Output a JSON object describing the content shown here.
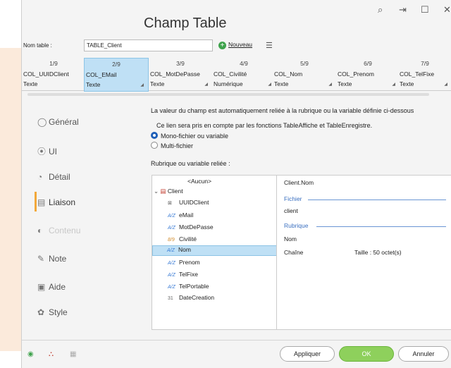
{
  "window": {
    "title": "Champ Table",
    "controls": [
      "⌕",
      "⇥",
      "☐",
      "✕"
    ]
  },
  "table_name": {
    "label": "Nom table :",
    "value": "TABLE_Client",
    "new_label": "Nouveau"
  },
  "columns": [
    {
      "index": "1/9",
      "name": "COL_UUIDClient",
      "type": "Texte"
    },
    {
      "index": "2/9",
      "name": "COL_EMail",
      "type": "Texte"
    },
    {
      "index": "3/9",
      "name": "COL_MotDePasse",
      "type": "Texte"
    },
    {
      "index": "4/9",
      "name": "COL_Civilité",
      "type": "Numérique"
    },
    {
      "index": "5/9",
      "name": "COL_Nom",
      "type": "Texte"
    },
    {
      "index": "6/9",
      "name": "COL_Prenom",
      "type": "Texte"
    },
    {
      "index": "7/9",
      "name": "COL_TelFixe",
      "type": "Texte"
    }
  ],
  "nav": [
    {
      "label": "Général",
      "icon": "◯"
    },
    {
      "label": "UI",
      "icon": "⦿"
    },
    {
      "label": "Détail",
      "icon": "◔"
    },
    {
      "label": "Liaison",
      "icon": "▤"
    },
    {
      "label": "Contenu",
      "icon": "◐"
    },
    {
      "label": "Note",
      "icon": "✎"
    },
    {
      "label": "Aide",
      "icon": "▣"
    },
    {
      "label": "Style",
      "icon": "✿"
    }
  ],
  "liaison": {
    "info1": "La valeur du champ est automatiquement reliée à la rubrique ou la variable définie ci-dessous",
    "info2": "Ce lien sera pris en compte par les fonctions TableAffiche et TableEnregistre.",
    "radio_mono": "Mono-fichier ou variable",
    "radio_multi": "Multi-fichier",
    "tree_label": "Rubrique ou variable reliée :",
    "tree": {
      "aucun": "<Aucun>",
      "file": "Client",
      "items": [
        "UUIDClient",
        "eMail",
        "MotDePasse",
        "Civilité",
        "Nom",
        "Prenom",
        "TelFixe",
        "TelPortable",
        "DateCreation"
      ]
    },
    "details": {
      "path": "Client.Nom",
      "fichier_label": "Fichier",
      "fichier_value": "client",
      "rubrique_label": "Rubrique",
      "rubrique_value": "Nom",
      "type": "Chaîne",
      "taille": "Taille : 50 octet(s)"
    }
  },
  "buttons": {
    "apply": "Appliquer",
    "ok": "OK",
    "cancel": "Annuler"
  }
}
